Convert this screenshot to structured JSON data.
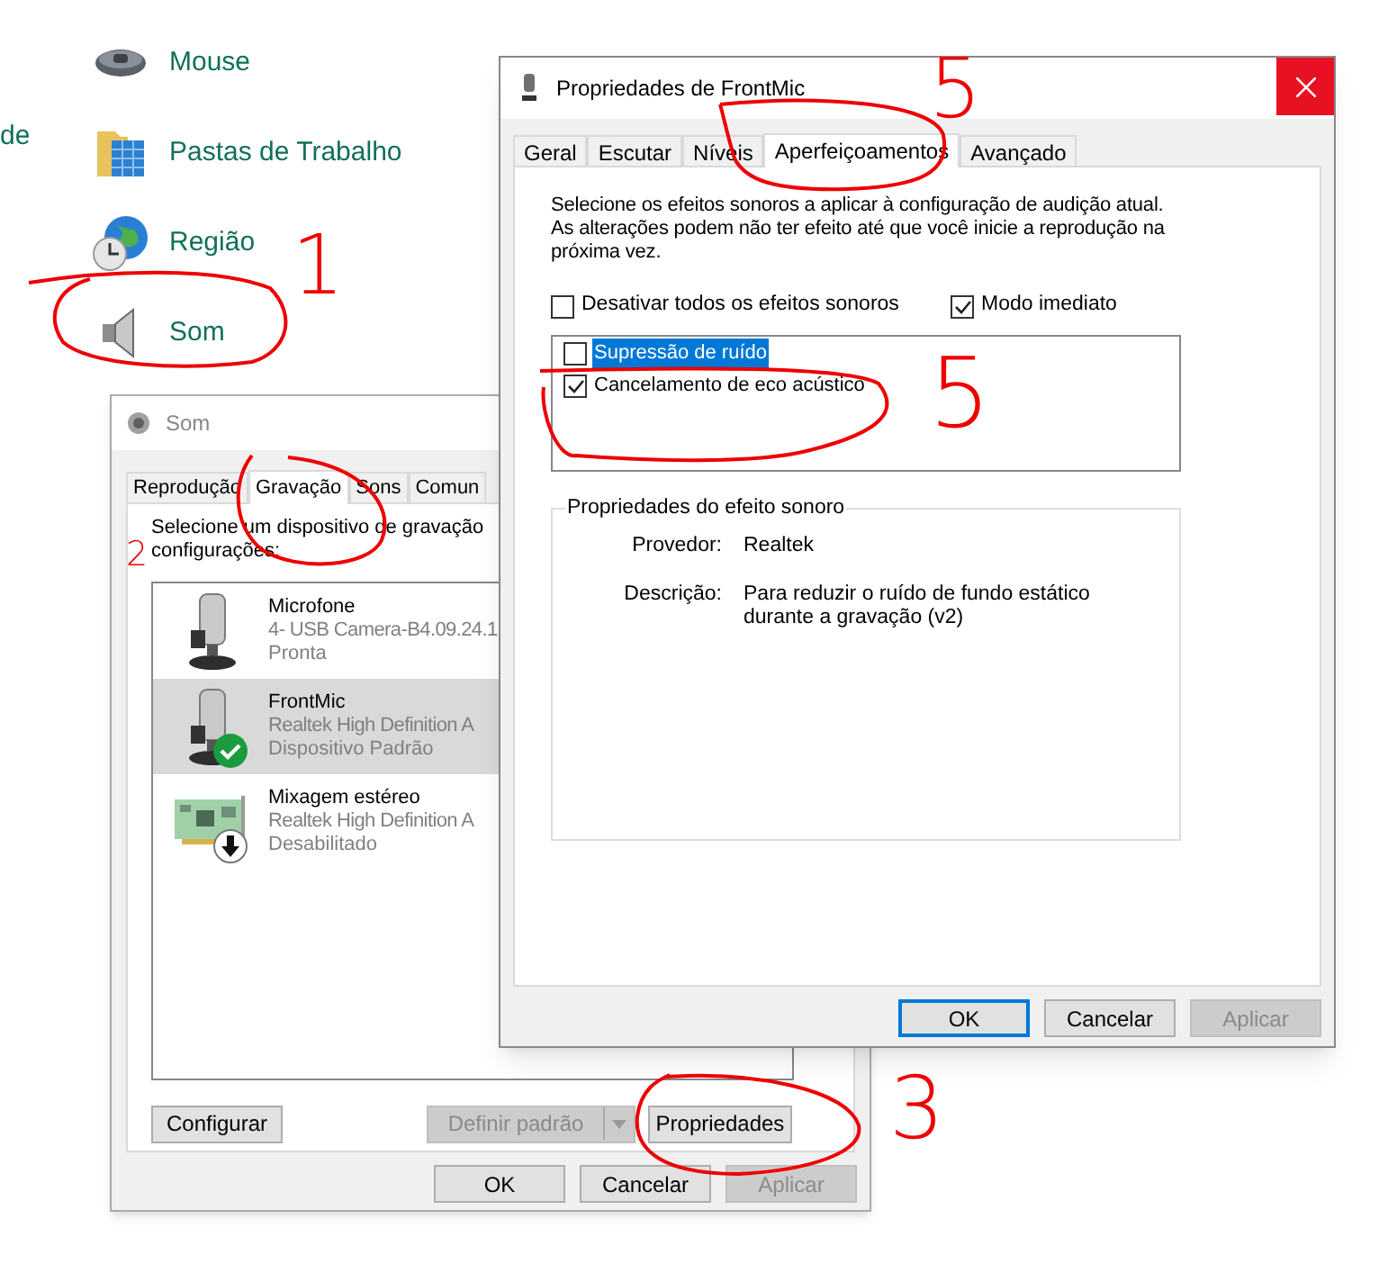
{
  "control_panel": {
    "side_text": "de",
    "items": [
      {
        "label": "Mouse"
      },
      {
        "label": "Pastas de Trabalho"
      },
      {
        "label": "Região"
      },
      {
        "label": "Som"
      }
    ]
  },
  "sound_window": {
    "title": "Som",
    "tabs": [
      {
        "label": "Reprodução",
        "selected": false
      },
      {
        "label": "Gravação",
        "selected": true
      },
      {
        "label": "Sons",
        "selected": false
      },
      {
        "label": "Comun",
        "selected": false
      }
    ],
    "instruction_lines": [
      "Selecione um dispositivo de gravação",
      "configurações:"
    ],
    "devices": [
      {
        "name": "Microfone",
        "detail": "4- USB Camera-B4.09.24.1",
        "status": "Pronta",
        "selected": false,
        "kind": "microphone",
        "default": false,
        "disabled": false
      },
      {
        "name": "FrontMic",
        "detail": "Realtek High Definition A",
        "status": "Dispositivo Padrão",
        "selected": true,
        "kind": "microphone",
        "default": true,
        "disabled": false
      },
      {
        "name": "Mixagem estéreo",
        "detail": "Realtek High Definition A",
        "status": "Desabilitado",
        "selected": false,
        "kind": "board",
        "default": false,
        "disabled": true
      }
    ],
    "configure_button": "Configurar",
    "set_default_button": {
      "label": "Definir padrão",
      "disabled": true
    },
    "properties_button": "Propriedades",
    "buttons": [
      {
        "label": "OK",
        "disabled": false
      },
      {
        "label": "Cancelar",
        "disabled": false
      },
      {
        "label": "Aplicar",
        "disabled": true
      }
    ]
  },
  "properties_window": {
    "title": "Propriedades de FrontMic",
    "tabs": [
      {
        "label": "Geral",
        "selected": false
      },
      {
        "label": "Escutar",
        "selected": false
      },
      {
        "label": "Níveis",
        "selected": false
      },
      {
        "label": "Aperfeiçoamentos",
        "selected": true
      },
      {
        "label": "Avançado",
        "selected": false
      }
    ],
    "description": "Selecione os efeitos sonoros a aplicar à configuração de audição atual. As alterações podem não ter efeito até que você inicie a reprodução na próxima vez.",
    "options": [
      {
        "label": "Desativar todos os efeitos sonoros",
        "checked": false
      },
      {
        "label": "Modo imediato",
        "checked": true
      }
    ],
    "effects": [
      {
        "label": "Supressão de ruído",
        "checked": false,
        "selected": true
      },
      {
        "label": "Cancelamento de eco acústico",
        "checked": true,
        "selected": false
      }
    ],
    "group": {
      "title": "Propriedades do efeito sonoro",
      "rows": [
        {
          "label": "Provedor:",
          "value": "Realtek"
        },
        {
          "label": "Descrição:",
          "value": "Para reduzir o ruído de fundo estático durante a gravação (v2)"
        }
      ]
    },
    "buttons": [
      {
        "label": "OK",
        "default": true,
        "disabled": false
      },
      {
        "label": "Cancelar",
        "default": false,
        "disabled": false
      },
      {
        "label": "Aplicar",
        "default": false,
        "disabled": true
      }
    ]
  },
  "annotations": [
    {
      "text": "1"
    },
    {
      "text": "2"
    },
    {
      "text": "5"
    },
    {
      "text": "5"
    },
    {
      "text": "3"
    }
  ]
}
